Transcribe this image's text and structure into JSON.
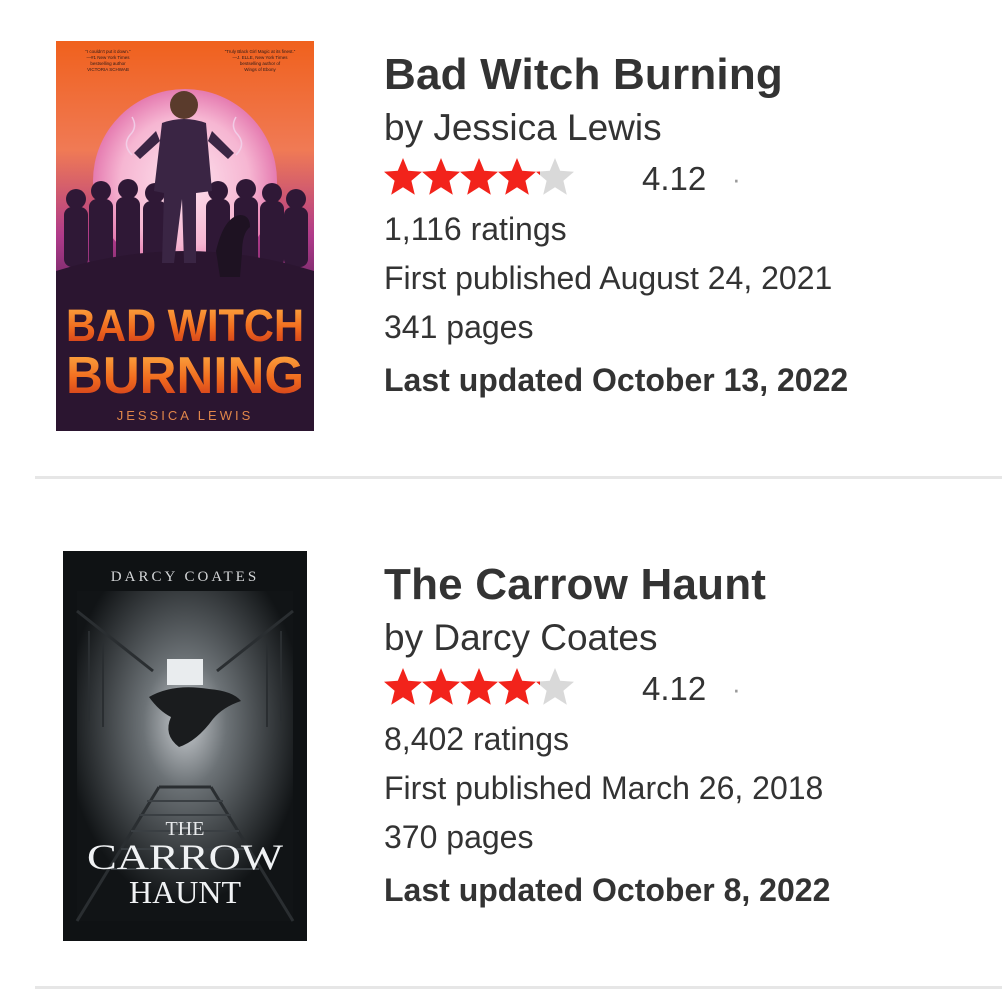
{
  "books": [
    {
      "title": "Bad Witch Burning",
      "author": "by Jessica Lewis",
      "rating": "4.12",
      "rating_fraction": 0.82,
      "separator": "·",
      "ratings_count": "1,116 ratings",
      "first_published": "First published August 24, 2021",
      "pages": "341 pages",
      "last_updated": "Last updated October 13, 2022",
      "cover": {
        "title_line1": "BAD WITCH",
        "title_line2": "BURNING",
        "author": "JESSICA LEWIS",
        "blurb_left": "“I couldn't put it down.” —#1 New York Times bestselling author VICTORIA SCHWAB",
        "blurb_right": "“Truly Black Girl Magic at its finest.” —J. ELLE, New York Times bestselling author of Wings of Ebony"
      }
    },
    {
      "title": "The Carrow Haunt",
      "author": "by Darcy Coates",
      "rating": "4.12",
      "rating_fraction": 0.82,
      "separator": "·",
      "ratings_count": "8,402 ratings",
      "first_published": "First published March 26, 2018",
      "pages": "370 pages",
      "last_updated": "Last updated October 8, 2022",
      "cover": {
        "author": "DARCY COATES",
        "title_line1": "THE",
        "title_line2": "CARROW",
        "title_line3": "HAUNT"
      }
    }
  ],
  "colors": {
    "star_filled": "#f2231b",
    "star_empty": "#d9d9d9",
    "divider": "#e6e6e6",
    "text": "#333333"
  }
}
